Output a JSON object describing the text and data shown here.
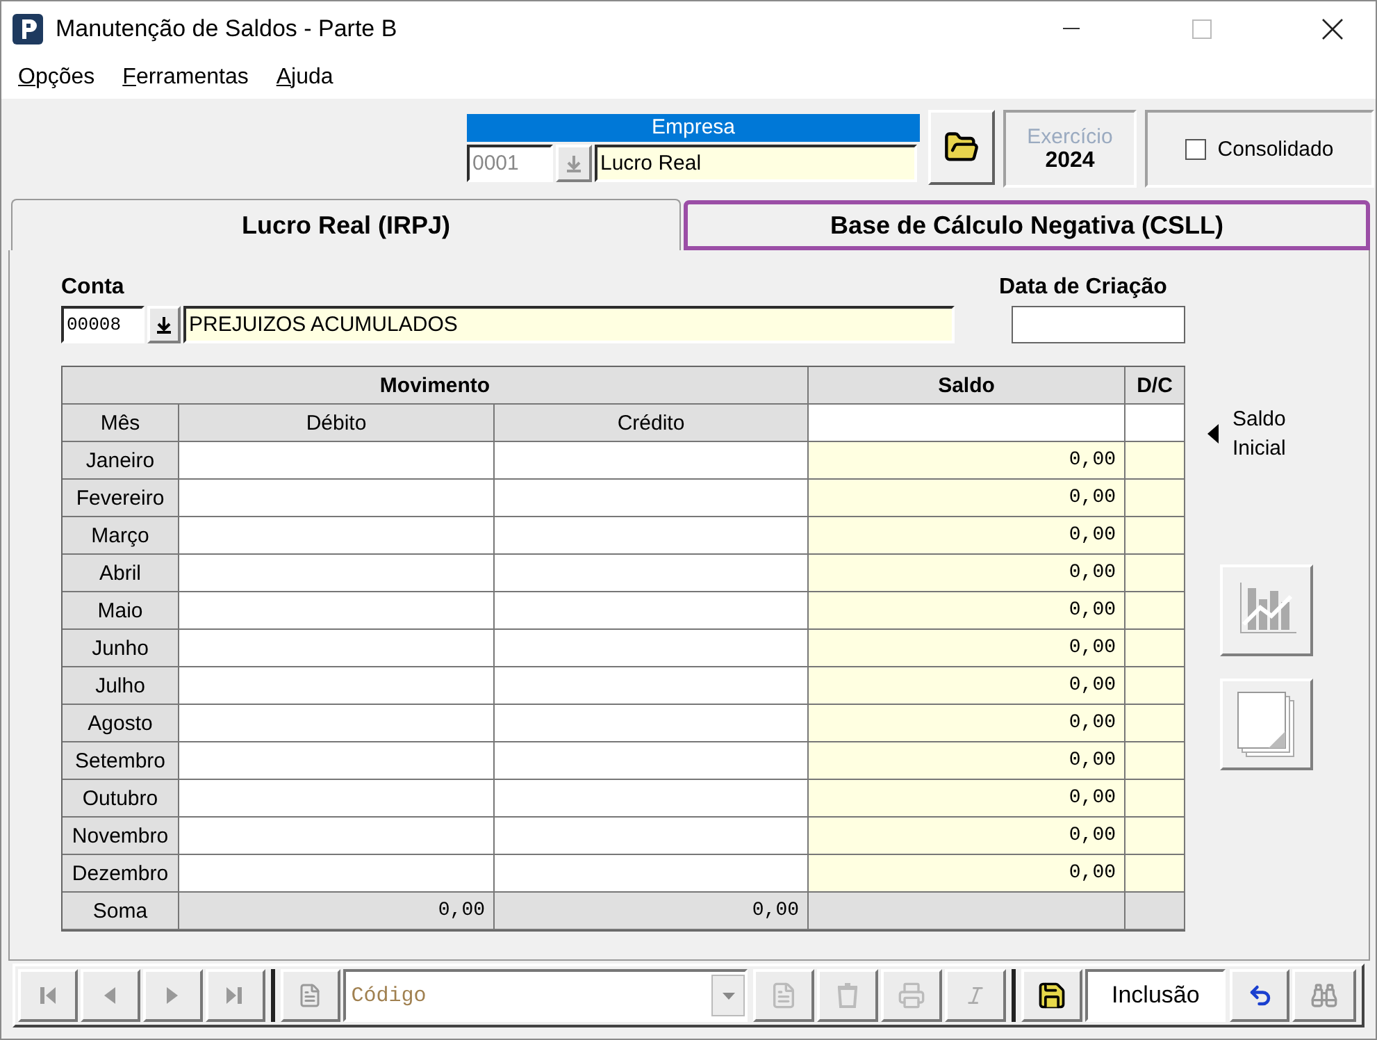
{
  "window": {
    "title": "Manutenção de Saldos - Parte B"
  },
  "menu": [
    {
      "label": "Opções"
    },
    {
      "label": "Ferramentas"
    },
    {
      "label": "Ajuda"
    }
  ],
  "empresa": {
    "label": "Empresa",
    "code": "0001",
    "name": "Lucro Real"
  },
  "exercicio": {
    "label": "Exercício",
    "year": "2024"
  },
  "consolidado": {
    "label": "Consolidado",
    "checked": false
  },
  "tabs": [
    {
      "label": "Lucro Real (IRPJ)",
      "selected": true,
      "highlighted": false
    },
    {
      "label": "Base de Cálculo Negativa (CSLL)",
      "selected": false,
      "highlighted": true
    }
  ],
  "conta": {
    "label": "Conta",
    "code": "00008",
    "name": "PREJUIZOS ACUMULADOS"
  },
  "data_criacao": {
    "label": "Data de Criação"
  },
  "table": {
    "group_headers": [
      "Movimento",
      "Saldo",
      "D/C"
    ],
    "columns": [
      "Mês",
      "Débito",
      "Crédito"
    ],
    "rows": [
      {
        "month": "Janeiro",
        "saldo": "0,00"
      },
      {
        "month": "Fevereiro",
        "saldo": "0,00"
      },
      {
        "month": "Março",
        "saldo": "0,00"
      },
      {
        "month": "Abril",
        "saldo": "0,00"
      },
      {
        "month": "Maio",
        "saldo": "0,00"
      },
      {
        "month": "Junho",
        "saldo": "0,00"
      },
      {
        "month": "Julho",
        "saldo": "0,00"
      },
      {
        "month": "Agosto",
        "saldo": "0,00"
      },
      {
        "month": "Setembro",
        "saldo": "0,00"
      },
      {
        "month": "Outubro",
        "saldo": "0,00"
      },
      {
        "month": "Novembro",
        "saldo": "0,00"
      },
      {
        "month": "Dezembro",
        "saldo": "0,00"
      }
    ],
    "total": {
      "label": "Soma",
      "debito": "0,00",
      "credito": "0,00"
    }
  },
  "saldo_inicial": "Saldo Inicial",
  "toolbar": {
    "code_placeholder": "Código",
    "mode": "Inclusão"
  }
}
